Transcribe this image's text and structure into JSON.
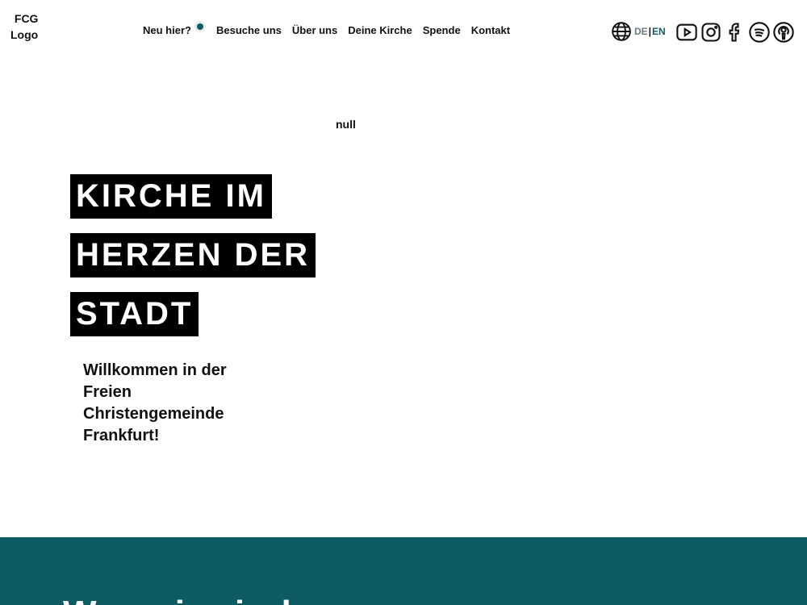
{
  "logo": {
    "alt": "FCG Logo"
  },
  "nav": {
    "items": [
      {
        "label": "Neu hier?"
      },
      {
        "label": "Besuche uns"
      },
      {
        "label": "Über uns"
      },
      {
        "label": "Deine Kirche"
      },
      {
        "label": "Spende"
      },
      {
        "label": "Kontakt"
      }
    ]
  },
  "language": {
    "de": "DE",
    "separator": "|",
    "en": "EN"
  },
  "social": [
    "youtube-icon",
    "instagram-icon",
    "facebook-icon",
    "spotify-icon",
    "podcast-icon"
  ],
  "hero": {
    "image_alt": "null",
    "headline": [
      "KIRCHE IM",
      "HERZEN DER",
      "STADT"
    ],
    "welcome": "Willkommen in der Freien Christengemeinde Frankfurt!"
  },
  "section": {
    "peek": "Wer wir sind"
  },
  "colors": {
    "brand": "#0d5c63",
    "text": "#111111",
    "headline_bg": "#000000"
  }
}
